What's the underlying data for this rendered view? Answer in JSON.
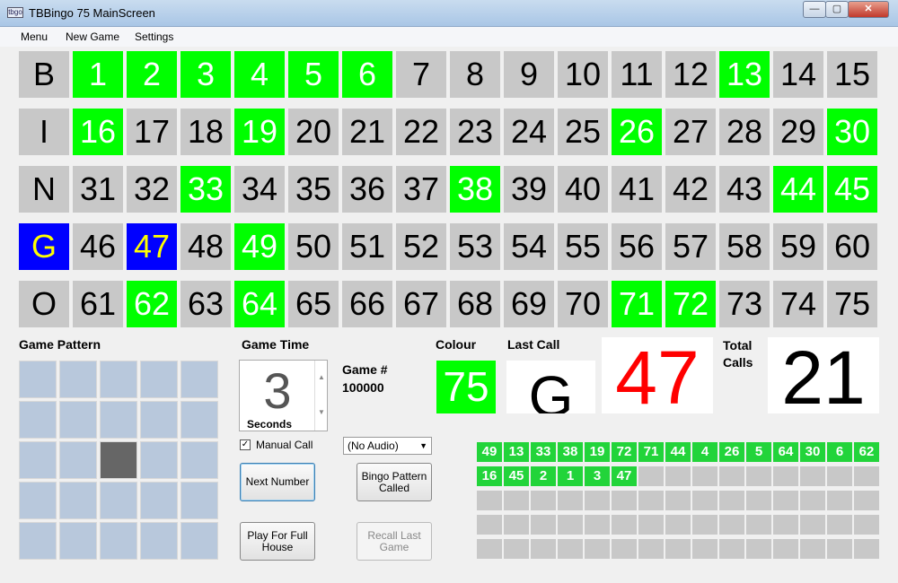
{
  "window": {
    "title": "TBBingo 75 MainScreen",
    "icon_label": "tbgo"
  },
  "menu": [
    "Menu",
    "New Game",
    "Settings"
  ],
  "board": {
    "rows": [
      {
        "letter": "B",
        "letter_last": false,
        "numbers": [
          1,
          2,
          3,
          4,
          5,
          6,
          7,
          8,
          9,
          10,
          11,
          12,
          13,
          14,
          15
        ]
      },
      {
        "letter": "I",
        "letter_last": false,
        "numbers": [
          16,
          17,
          18,
          19,
          20,
          21,
          22,
          23,
          24,
          25,
          26,
          27,
          28,
          29,
          30
        ]
      },
      {
        "letter": "N",
        "letter_last": false,
        "numbers": [
          31,
          32,
          33,
          34,
          35,
          36,
          37,
          38,
          39,
          40,
          41,
          42,
          43,
          44,
          45
        ]
      },
      {
        "letter": "G",
        "letter_last": true,
        "numbers": [
          46,
          47,
          48,
          49,
          50,
          51,
          52,
          53,
          54,
          55,
          56,
          57,
          58,
          59,
          60
        ]
      },
      {
        "letter": "O",
        "letter_last": false,
        "numbers": [
          61,
          62,
          63,
          64,
          65,
          66,
          67,
          68,
          69,
          70,
          71,
          72,
          73,
          74,
          75
        ]
      }
    ],
    "called": [
      1,
      2,
      3,
      4,
      5,
      6,
      13,
      16,
      19,
      26,
      30,
      33,
      38,
      44,
      45,
      49,
      62,
      64,
      71,
      72
    ],
    "last_called": 47
  },
  "labels": {
    "game_pattern": "Game Pattern",
    "game_time": "Game Time",
    "game_number_label": "Game #",
    "game_number": "100000",
    "colour": "Colour",
    "last_call": "Last Call",
    "total_calls": "Total\nCalls"
  },
  "pattern": {
    "cols": 5,
    "rows": 5,
    "on": [
      [
        2,
        2
      ]
    ]
  },
  "timer": {
    "value": "3",
    "unit": "Seconds"
  },
  "manual_call": {
    "checked": true,
    "label": "Manual Call",
    "mark": "✓"
  },
  "audio_select": {
    "value": "(No Audio)"
  },
  "buttons": {
    "next_number": "Next Number",
    "bingo_pattern": "Bingo Pattern Called",
    "play_full_house": "Play For Full House",
    "recall_last": "Recall Last Game"
  },
  "colour_value": "75",
  "last_call": {
    "letter": "G",
    "number": "47"
  },
  "total_calls": "21",
  "call_history": [
    49,
    13,
    33,
    38,
    19,
    72,
    71,
    44,
    4,
    26,
    5,
    64,
    30,
    6,
    62,
    16,
    45,
    2,
    1,
    3,
    47
  ],
  "call_grid": {
    "cols": 15,
    "rows": 5
  },
  "colors": {
    "called": "#00ff00",
    "last": "#0000ff",
    "last_text": "#ffff00",
    "uncalled": "#c8c8c8",
    "last_number": "#ff0000"
  }
}
